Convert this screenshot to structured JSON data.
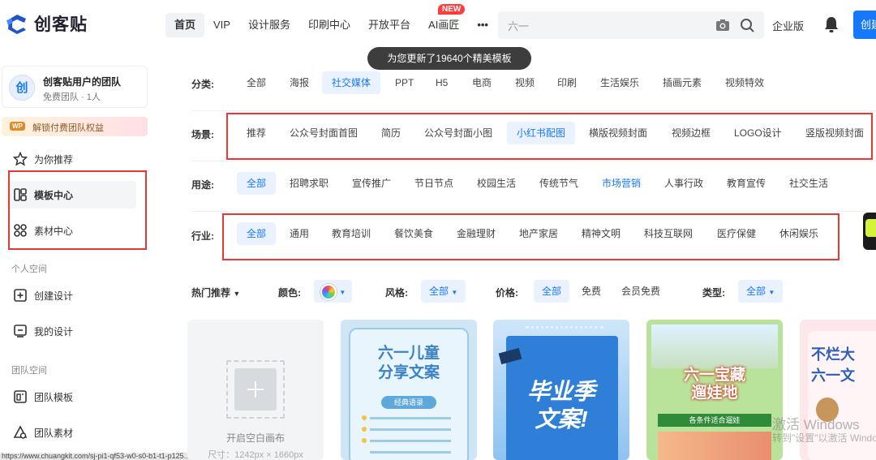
{
  "brand": {
    "name": "创客贴"
  },
  "nav": {
    "items": [
      "首页",
      "VIP",
      "设计服务",
      "印刷中心",
      "开放平台",
      "AI画匠"
    ],
    "active": "首页",
    "new_badge": "NEW",
    "more": "•••"
  },
  "search": {
    "value": "六一"
  },
  "header": {
    "enterprise": "企业版",
    "create": "创建"
  },
  "toast": "为您更新了19640个精美模板",
  "sidebar": {
    "team_avatar": "创",
    "team_name": "创客贴用户的团队",
    "team_sub": "免费团队 · 1人",
    "benefit_tag": "WP",
    "benefit": "解锁付费团队权益",
    "items": [
      {
        "label": "为你推荐",
        "icon": "star-icon"
      },
      {
        "label": "模板中心",
        "icon": "template-icon"
      },
      {
        "label": "素材中心",
        "icon": "material-icon"
      }
    ],
    "personal_section": "个人空间",
    "personal_items": [
      {
        "label": "创建设计",
        "icon": "add-design-icon"
      },
      {
        "label": "我的设计",
        "icon": "my-design-icon"
      }
    ],
    "team_section": "团队空间",
    "team_items": [
      {
        "label": "团队模板",
        "icon": "team-template-icon"
      },
      {
        "label": "团队素材",
        "icon": "team-material-icon"
      }
    ]
  },
  "status_url": "https://www.chuangkit.com/sj-pi1-qf53-w0-s0-b1-t1-p125...htm",
  "filters": {
    "category": {
      "label": "分类:",
      "options": [
        "全部",
        "海报",
        "社交媒体",
        "PPT",
        "H5",
        "电商",
        "视频",
        "印刷",
        "生活娱乐",
        "插画元素",
        "视频特效"
      ],
      "selected": "社交媒体"
    },
    "scene": {
      "label": "场景:",
      "options": [
        "推荐",
        "公众号封面首图",
        "简历",
        "公众号封面小图",
        "小红书配图",
        "横版视频封面",
        "视频边框",
        "LOGO设计",
        "竖版视频封面"
      ],
      "selected": "小红书配图"
    },
    "usage": {
      "label": "用途:",
      "options": [
        "全部",
        "招聘求职",
        "宣传推广",
        "节日节点",
        "校园生活",
        "传统节气",
        "市场营销",
        "人事行政",
        "教育宣传",
        "社交生活"
      ],
      "selected": "全部",
      "highlight": "市场营销"
    },
    "industry": {
      "label": "行业:",
      "options": [
        "全部",
        "通用",
        "教育培训",
        "餐饮美食",
        "金融理财",
        "地产家居",
        "精神文明",
        "科技互联网",
        "医疗保健",
        "休闲娱乐"
      ],
      "selected": "全部"
    }
  },
  "options_bar": {
    "hot": "热门推荐",
    "color_label": "颜色:",
    "style_label": "风格:",
    "style_value": "全部",
    "price_label": "价格:",
    "price_options": [
      "全部",
      "免费",
      "会员免费"
    ],
    "type_label": "类型:",
    "type_value": "全部"
  },
  "blank_card": {
    "label": "开启空白画布",
    "size": "尺寸：1242px × 1660px"
  },
  "templates": [
    {
      "title_lines": [
        "六一儿童",
        "分享文案"
      ],
      "sub": "经典语录"
    },
    {
      "title_lines": [
        "毕业季",
        "文案!"
      ]
    },
    {
      "title_lines": [
        "六一宝藏",
        "遛娃地"
      ],
      "sub": "各条件适合遛娃"
    },
    {
      "title_lines": [
        "不烂大",
        "六一文"
      ]
    }
  ],
  "watermark": {
    "line1": "激活 Windows",
    "line2": "转到\"设置\"以激活 Windows。"
  }
}
